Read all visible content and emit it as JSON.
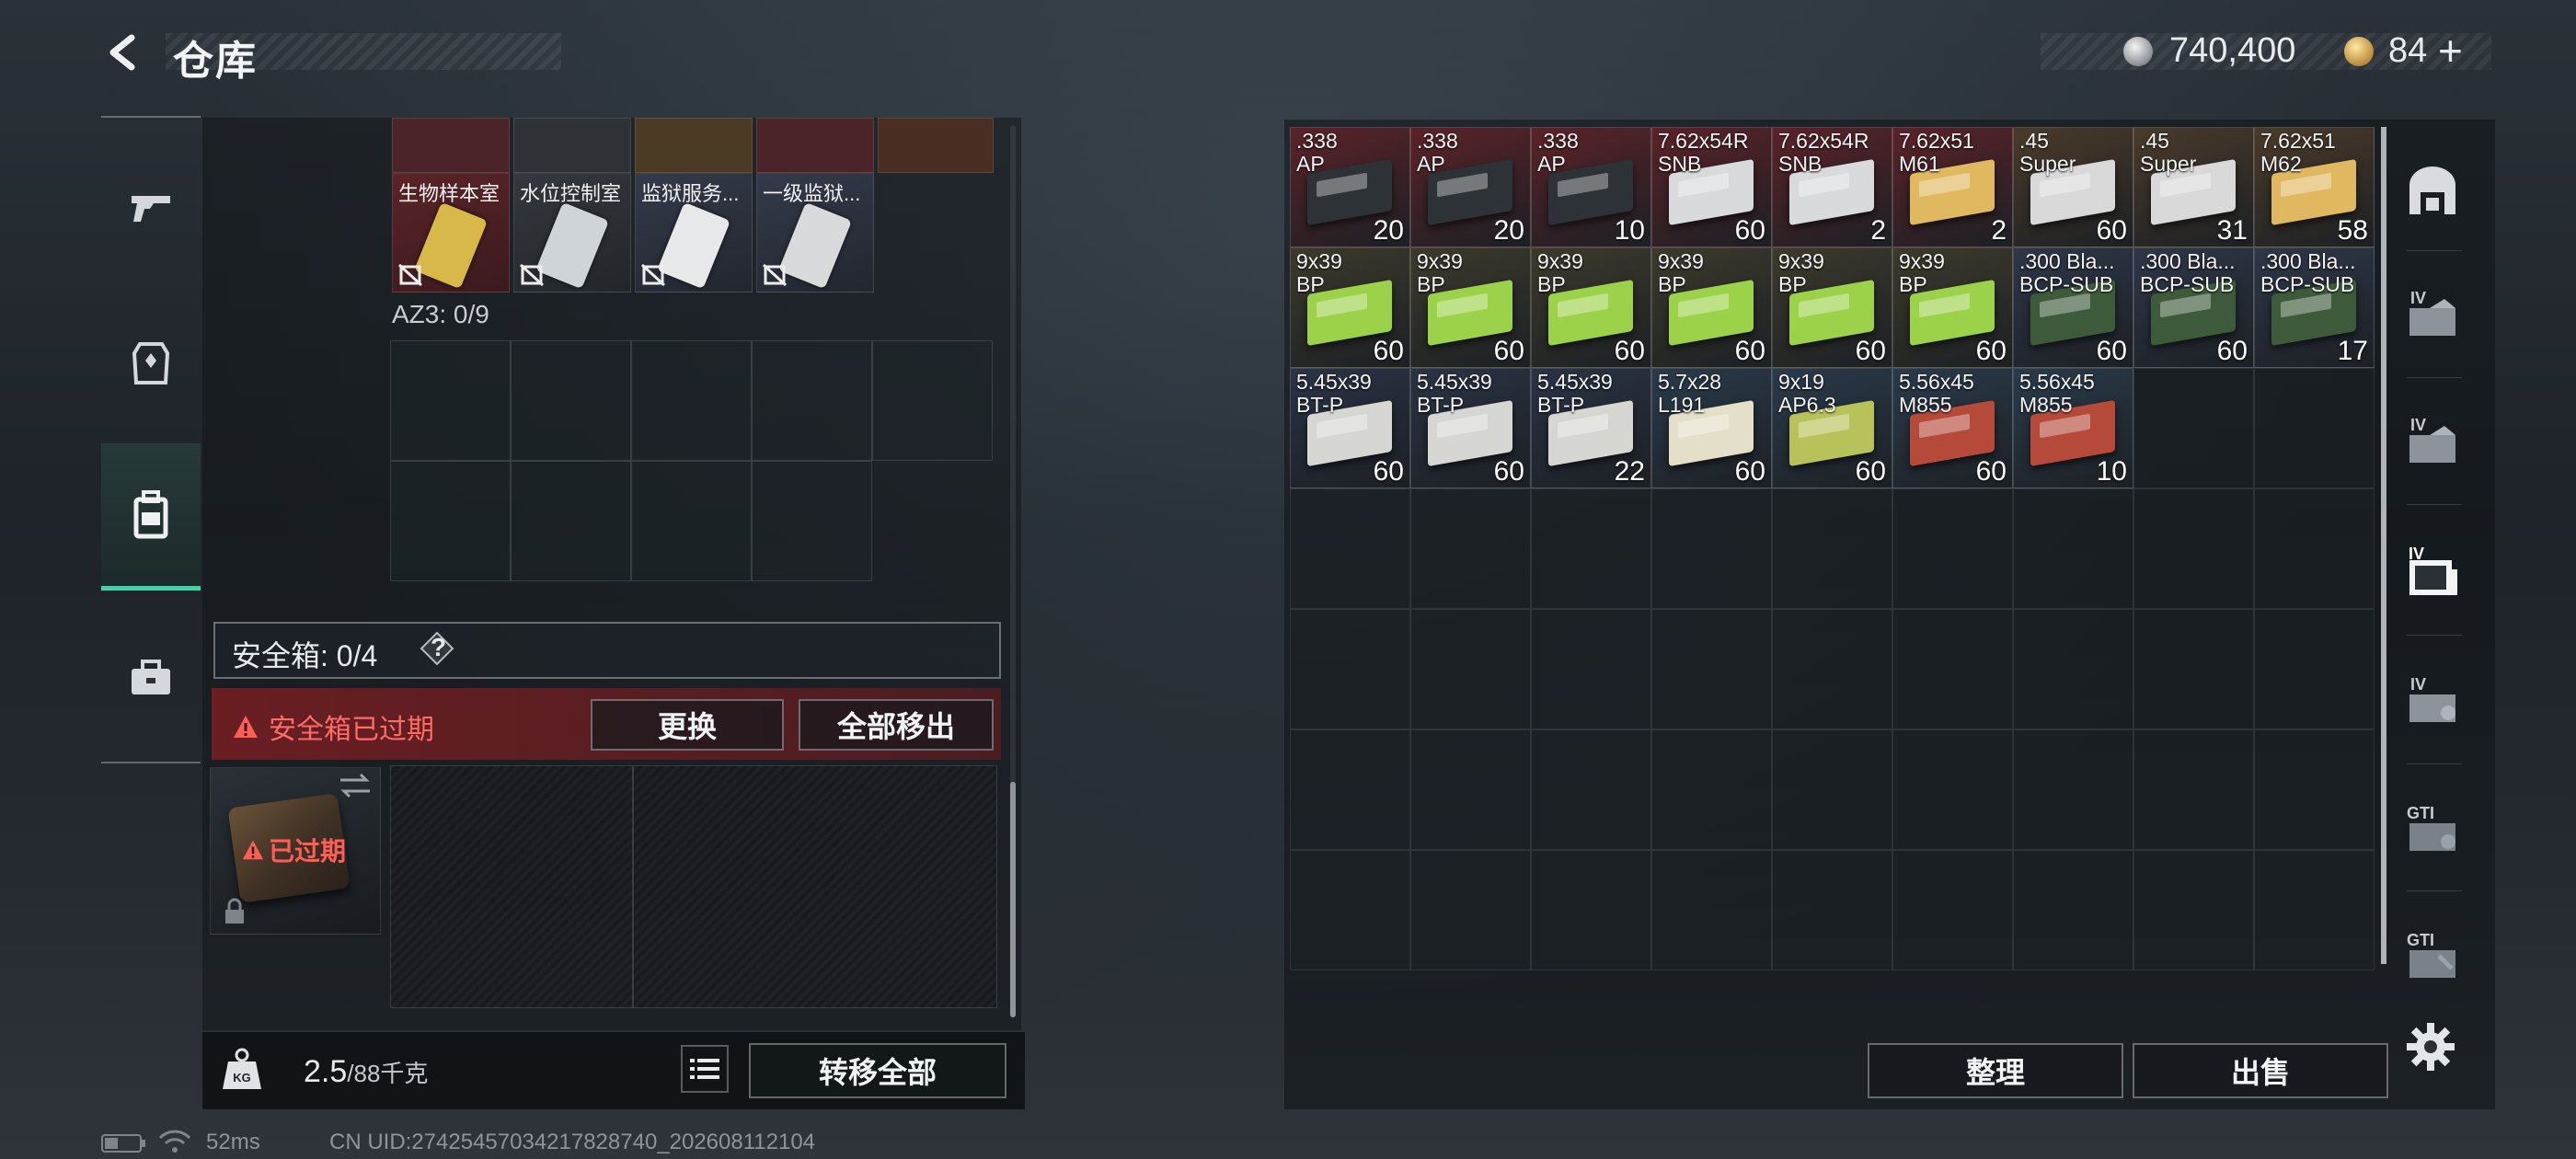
{
  "header": {
    "title": "仓库",
    "silver_amount": "740,400",
    "gold_amount": "84",
    "plus_label": "+"
  },
  "left_nav": [
    "weapon-icon",
    "armor-icon",
    "backpack-icon",
    "toolbox-icon"
  ],
  "keys": [
    {
      "label": "生物样本室",
      "color": "#d9b84a"
    },
    {
      "label": "水位控制室",
      "color": "#cfd4d8"
    },
    {
      "label": "监狱服务...",
      "color": "#e6e8ea"
    },
    {
      "label": "一级监狱...",
      "color": "#d8dadc"
    }
  ],
  "az3_label": "AZ3: 0/9",
  "safe_box": {
    "title": "安全箱: 0/4",
    "help": "?",
    "expired_notice": "安全箱已过期",
    "replace_label": "更换",
    "move_all_label": "全部移出",
    "tile_expired": "已过期"
  },
  "bottom": {
    "weight": "2.5",
    "weight_unit": "/88千克",
    "transfer_all_label": "转移全部"
  },
  "status": {
    "ping": "52ms",
    "uid": "CN UID:27425457034217828740_202608112104"
  },
  "items": [
    {
      "name": ".338\nAP",
      "qty": "20",
      "bg": "#5a2228",
      "box": "#2d3236"
    },
    {
      "name": ".338\nAP",
      "qty": "20",
      "bg": "#5a2228",
      "box": "#2d3236"
    },
    {
      "name": ".338\nAP",
      "qty": "10",
      "bg": "#5a2228",
      "box": "#2d3236"
    },
    {
      "name": "7.62x54R\nSNB",
      "qty": "60",
      "bg": "#5a2228",
      "box": "#d8dadc"
    },
    {
      "name": "7.62x54R\nSNB",
      "qty": "2",
      "bg": "#5a2228",
      "box": "#d8dadc"
    },
    {
      "name": "7.62x51\nM61",
      "qty": "2",
      "bg": "#5a2228",
      "box": "#e0b860"
    },
    {
      "name": ".45\nSuper",
      "qty": "60",
      "bg": "#4a3a2a",
      "box": "#d9d9d9"
    },
    {
      "name": ".45\nSuper",
      "qty": "31",
      "bg": "#4a3a2a",
      "box": "#d9d9d9"
    },
    {
      "name": "7.62x51\nM62",
      "qty": "58",
      "bg": "#4a3a2a",
      "box": "#e0b860"
    },
    {
      "name": "9x39\nBP",
      "qty": "60",
      "bg": "#3c3a2c",
      "box": "#9cd24a"
    },
    {
      "name": "9x39\nBP",
      "qty": "60",
      "bg": "#3c3a2c",
      "box": "#9cd24a"
    },
    {
      "name": "9x39\nBP",
      "qty": "60",
      "bg": "#3c3a2c",
      "box": "#9cd24a"
    },
    {
      "name": "9x39\nBP",
      "qty": "60",
      "bg": "#3c3a2c",
      "box": "#9cd24a"
    },
    {
      "name": "9x39\nBP",
      "qty": "60",
      "bg": "#3c3a2c",
      "box": "#9cd24a"
    },
    {
      "name": "9x39\nBP",
      "qty": "60",
      "bg": "#3c3a2c",
      "box": "#9cd24a"
    },
    {
      "name": ".300 Bla...\nBCP-SUB",
      "qty": "60",
      "bg": "#2e3648",
      "box": "#3d5a3a"
    },
    {
      "name": ".300 Bla...\nBCP-SUB",
      "qty": "60",
      "bg": "#2e3648",
      "box": "#3d5a3a"
    },
    {
      "name": ".300 Bla...\nBCP-SUB",
      "qty": "17",
      "bg": "#2e3648",
      "box": "#3d5a3a"
    },
    {
      "name": "5.45x39\nBT-P",
      "qty": "60",
      "bg": "#2a3244",
      "box": "#d6d6d2"
    },
    {
      "name": "5.45x39\nBT-P",
      "qty": "60",
      "bg": "#2a3244",
      "box": "#d6d6d2"
    },
    {
      "name": "5.45x39\nBT-P",
      "qty": "22",
      "bg": "#2a3244",
      "box": "#d6d6d2"
    },
    {
      "name": "5.7x28\nL191",
      "qty": "60",
      "bg": "#2a3a4a",
      "box": "#e3dfc8"
    },
    {
      "name": "9x19\nAP6.3",
      "qty": "60",
      "bg": "#2a3a4a",
      "box": "#b7c25a"
    },
    {
      "name": "5.56x45\nM855",
      "qty": "60",
      "bg": "#2a3a4a",
      "box": "#b54a3a"
    },
    {
      "name": "5.56x45\nM855",
      "qty": "10",
      "bg": "#2a3a4a",
      "box": "#b54a3a"
    }
  ],
  "right_nav": [
    {
      "icon": "vault-icon",
      "label": ""
    },
    {
      "icon": "storage-iv-icon",
      "label": "IV"
    },
    {
      "icon": "storage-iv-icon",
      "label": "IV"
    },
    {
      "icon": "storage-iv-folder-icon",
      "label": "IV"
    },
    {
      "icon": "storage-iv-icon",
      "label": "IV"
    },
    {
      "icon": "storage-gti-icon",
      "label": "GTI"
    },
    {
      "icon": "storage-gti-icon",
      "label": "GTI"
    }
  ],
  "actions": {
    "sort_label": "整理",
    "sell_label": "出售"
  },
  "colors": {
    "accent": "#3fd3a6",
    "danger": "#ff5e57",
    "expired_bg": "#7a1e22"
  }
}
